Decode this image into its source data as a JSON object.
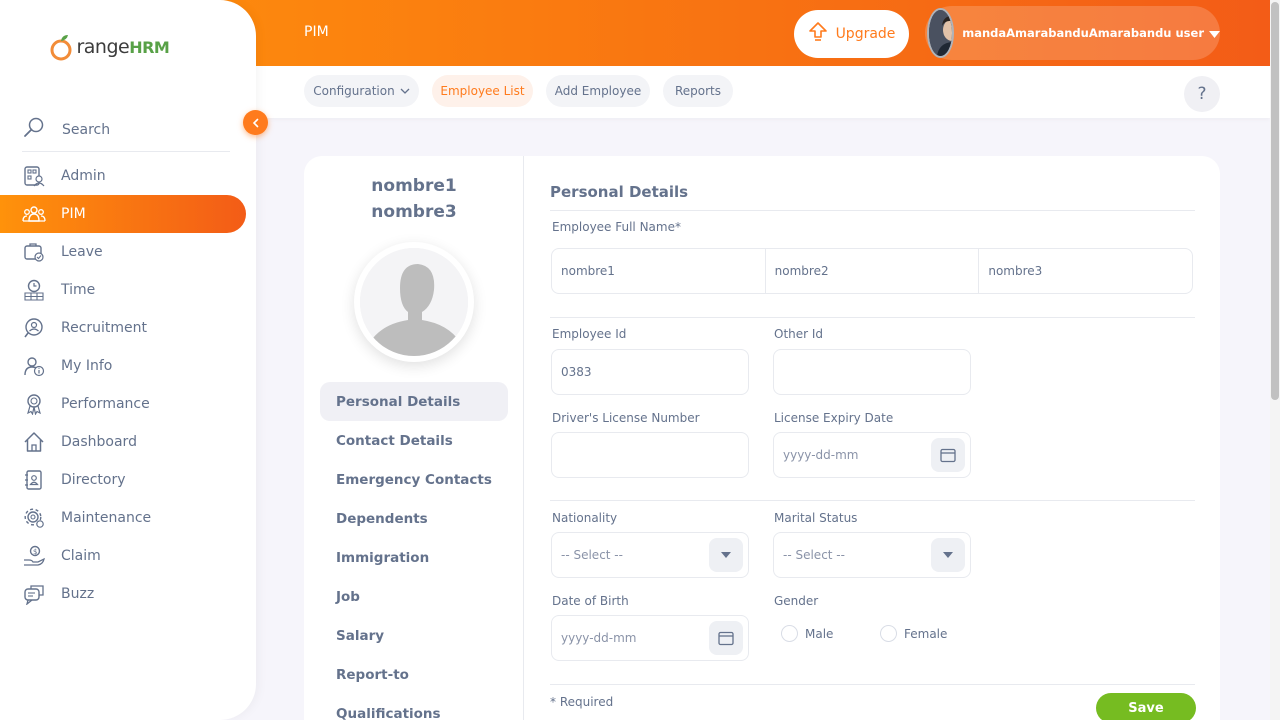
{
  "brand": {
    "o": "O",
    "range": "range",
    "hrm": "HRM"
  },
  "sidebar": {
    "search_label": "Search",
    "items": [
      {
        "label": "Admin"
      },
      {
        "label": "PIM"
      },
      {
        "label": "Leave"
      },
      {
        "label": "Time"
      },
      {
        "label": "Recruitment"
      },
      {
        "label": "My Info"
      },
      {
        "label": "Performance"
      },
      {
        "label": "Dashboard"
      },
      {
        "label": "Directory"
      },
      {
        "label": "Maintenance"
      },
      {
        "label": "Claim"
      },
      {
        "label": "Buzz"
      }
    ],
    "active_item": "PIM"
  },
  "header": {
    "title": "PIM",
    "upgrade_label": "Upgrade",
    "user_name": "mandaAmarabanduAmarabandu user"
  },
  "subnav": {
    "tabs": [
      {
        "label": "Configuration"
      },
      {
        "label": "Employee List"
      },
      {
        "label": "Add Employee"
      },
      {
        "label": "Reports"
      }
    ],
    "active_tab": "Employee List",
    "help_label": "?"
  },
  "employee": {
    "name_line1": "nombre1",
    "name_line2": "nombre3"
  },
  "sections": [
    {
      "label": "Personal Details"
    },
    {
      "label": "Contact Details"
    },
    {
      "label": "Emergency Contacts"
    },
    {
      "label": "Dependents"
    },
    {
      "label": "Immigration"
    },
    {
      "label": "Job"
    },
    {
      "label": "Salary"
    },
    {
      "label": "Report-to"
    },
    {
      "label": "Qualifications"
    }
  ],
  "form": {
    "title": "Personal Details",
    "full_name_label": "Employee Full Name*",
    "first_name": "nombre1",
    "middle_name": "nombre2",
    "last_name": "nombre3",
    "employee_id_label": "Employee Id",
    "employee_id": "0383",
    "other_id_label": "Other Id",
    "other_id": "",
    "license_label": "Driver's License Number",
    "license": "",
    "expiry_label": "License Expiry Date",
    "expiry_placeholder": "yyyy-dd-mm",
    "nationality_label": "Nationality",
    "nationality_value": "-- Select --",
    "marital_label": "Marital Status",
    "marital_value": "-- Select --",
    "dob_label": "Date of Birth",
    "dob_placeholder": "yyyy-dd-mm",
    "gender_label": "Gender",
    "gender_options": [
      "Male",
      "Female"
    ],
    "required_note": "* Required",
    "save_label": "Save"
  },
  "colors": {
    "brand_orange": "#ff7b1d",
    "save_green": "#76bc21",
    "text": "#64728c"
  }
}
